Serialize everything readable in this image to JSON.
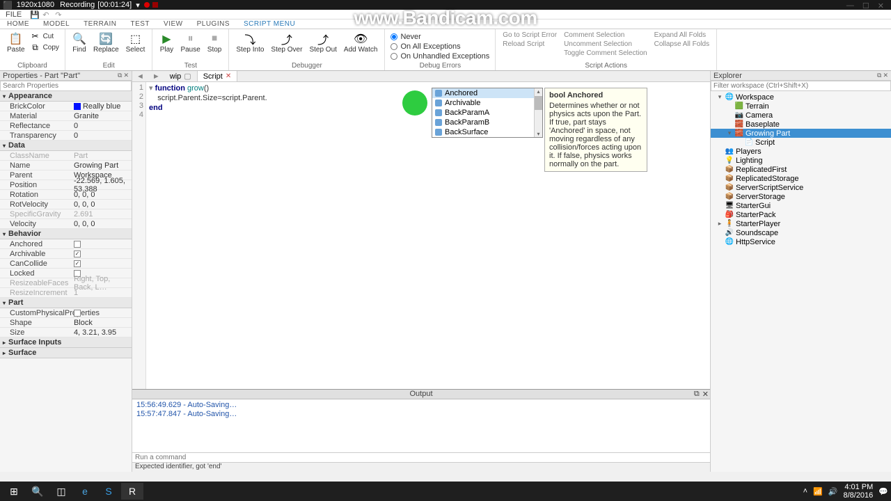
{
  "watermark": "www.Bandicam.com",
  "titlebar": {
    "res": "1920x1080",
    "recording": "Recording",
    "time": "[00:01:24]"
  },
  "menubar": {
    "file": "FILE"
  },
  "tabs": [
    "HOME",
    "MODEL",
    "TERRAIN",
    "TEST",
    "VIEW",
    "PLUGINS",
    "SCRIPT MENU"
  ],
  "activeTab": 6,
  "ribbon": {
    "clipboard": {
      "paste": "Paste",
      "cut": "Cut",
      "copy": "Copy",
      "label": "Clipboard"
    },
    "edit": {
      "find": "Find",
      "replace": "Replace",
      "select": "Select",
      "label": "Edit"
    },
    "test": {
      "play": "Play",
      "pause": "Pause",
      "stop": "Stop",
      "label": "Test"
    },
    "debugger": {
      "stepinto": "Step\nInto",
      "stepover": "Step\nOver",
      "stepout": "Step\nOut",
      "addwatch": "Add\nWatch",
      "label": "Debugger"
    },
    "errors": {
      "never": "Never",
      "onall": "On All Exceptions",
      "onunhandled": "On Unhandled Exceptions",
      "label": "Debug Errors"
    },
    "scriptactions": {
      "gotoerr": "Go to Script Error",
      "reload": "Reload Script",
      "comment": "Comment Selection",
      "uncomment": "Uncomment Selection",
      "toggle": "Toggle Comment Selection",
      "expand": "Expand All Folds",
      "collapse": "Collapse All Folds",
      "label": "Script Actions"
    }
  },
  "propertiesPanel": {
    "title": "Properties - Part \"Part\"",
    "searchPlaceholder": "Search Properties",
    "sections": {
      "appearance": "Appearance",
      "data": "Data",
      "behavior": "Behavior",
      "part": "Part",
      "surfaceInputs": "Surface Inputs",
      "surface": "Surface"
    },
    "props": {
      "brickcolor_n": "BrickColor",
      "brickcolor_v": "Really blue",
      "brickcolor_hex": "#0010ff",
      "material_n": "Material",
      "material_v": "Granite",
      "reflectance_n": "Reflectance",
      "reflectance_v": "0",
      "transparency_n": "Transparency",
      "transparency_v": "0",
      "classname_n": "ClassName",
      "classname_v": "Part",
      "name_n": "Name",
      "name_v": "Growing Part",
      "parent_n": "Parent",
      "parent_v": "Workspace",
      "position_n": "Position",
      "position_v": "-22.569, 1.605, 53.388",
      "rotation_n": "Rotation",
      "rotation_v": "0, 0, 0",
      "rotvel_n": "RotVelocity",
      "rotvel_v": "0, 0, 0",
      "specgrav_n": "SpecificGravity",
      "specgrav_v": "2.691",
      "velocity_n": "Velocity",
      "velocity_v": "0, 0, 0",
      "anchored_n": "Anchored",
      "archivable_n": "Archivable",
      "cancollide_n": "CanCollide",
      "locked_n": "Locked",
      "resizefaces_n": "ResizeableFaces",
      "resizefaces_v": "Right, Top, Back, L…",
      "resizeinc_n": "ResizeIncrement",
      "resizeinc_v": "1",
      "customphys_n": "CustomPhysicalProperties",
      "shape_n": "Shape",
      "shape_v": "Block",
      "size_n": "Size",
      "size_v": "4, 3.21, 3.95"
    }
  },
  "explorer": {
    "title": "Explorer",
    "filterPlaceholder": "Filter workspace (Ctrl+Shift+X)",
    "items": [
      {
        "name": "Workspace",
        "depth": 0,
        "exp": "▾",
        "icon": "🌐"
      },
      {
        "name": "Terrain",
        "depth": 1,
        "exp": "",
        "icon": "🟩"
      },
      {
        "name": "Camera",
        "depth": 1,
        "exp": "",
        "icon": "📷"
      },
      {
        "name": "Baseplate",
        "depth": 1,
        "exp": "",
        "icon": "🧱"
      },
      {
        "name": "Growing Part",
        "depth": 1,
        "exp": "▾",
        "icon": "🧱",
        "selected": true
      },
      {
        "name": "Script",
        "depth": 2,
        "exp": "",
        "icon": "📄"
      },
      {
        "name": "Players",
        "depth": 0,
        "exp": "",
        "icon": "👥"
      },
      {
        "name": "Lighting",
        "depth": 0,
        "exp": "",
        "icon": "💡"
      },
      {
        "name": "ReplicatedFirst",
        "depth": 0,
        "exp": "",
        "icon": "📦"
      },
      {
        "name": "ReplicatedStorage",
        "depth": 0,
        "exp": "",
        "icon": "📦"
      },
      {
        "name": "ServerScriptService",
        "depth": 0,
        "exp": "",
        "icon": "📦"
      },
      {
        "name": "ServerStorage",
        "depth": 0,
        "exp": "",
        "icon": "📦"
      },
      {
        "name": "StarterGui",
        "depth": 0,
        "exp": "",
        "icon": "🖥"
      },
      {
        "name": "StarterPack",
        "depth": 0,
        "exp": "",
        "icon": "🎒"
      },
      {
        "name": "StarterPlayer",
        "depth": 0,
        "exp": "▸",
        "icon": "🧍"
      },
      {
        "name": "Soundscape",
        "depth": 0,
        "exp": "",
        "icon": "🔊"
      },
      {
        "name": "HttpService",
        "depth": 0,
        "exp": "",
        "icon": "🌐"
      }
    ]
  },
  "docTabs": {
    "tab1": "wip",
    "tab2": "Script"
  },
  "code": {
    "lines": [
      "1",
      "2",
      "3",
      "4"
    ],
    "l1a": "function ",
    "l1b": "grow",
    "l1c": "()",
    "l2": "    script.Parent.Size=script.Parent.",
    "l3": "end"
  },
  "autocomplete": [
    "Anchored",
    "Archivable",
    "BackParamA",
    "BackParamB",
    "BackSurface"
  ],
  "tooltip": {
    "title": "bool Anchored",
    "body": "Determines whether or not physics acts upon the Part. If true, part stays 'Anchored' in space, not moving regardless of any collision/forces acting upon it. If false, physics works normally on the part."
  },
  "output": {
    "title": "Output",
    "lines": [
      "15:56:49.629 - Auto-Saving…",
      "15:57:47.847 - Auto-Saving…"
    ]
  },
  "cmdPlaceholder": "Run a command",
  "statusBar": "Expected identifier, got 'end'",
  "taskbar": {
    "time": "4:01 PM",
    "date": "8/8/2016"
  }
}
